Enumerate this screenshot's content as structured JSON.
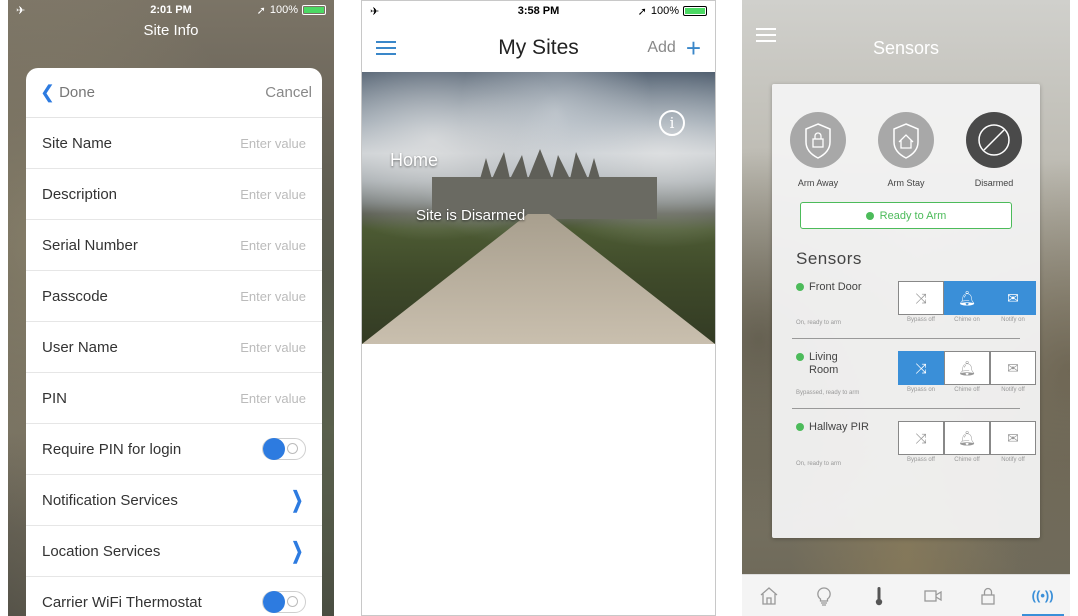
{
  "screen1": {
    "status": {
      "time": "2:01 PM",
      "battery": "100%"
    },
    "title": "Site Info",
    "done": "Done",
    "cancel": "Cancel",
    "placeholder": "Enter value",
    "fields": [
      {
        "label": "Site Name"
      },
      {
        "label": "Description"
      },
      {
        "label": "Serial Number"
      },
      {
        "label": "Passcode"
      },
      {
        "label": "User Name"
      },
      {
        "label": "PIN"
      }
    ],
    "require_pin": "Require PIN for login",
    "notification": "Notification Services",
    "location": "Location Services",
    "thermostat": "Carrier WiFi Thermostat"
  },
  "screen2": {
    "status": {
      "time": "3:58 PM",
      "battery": "100%"
    },
    "title": "My Sites",
    "add": "Add",
    "site_name": "Home",
    "site_status": "Site is Disarmed"
  },
  "screen3": {
    "title": "Sensors",
    "modes": [
      {
        "label": "Arm Away",
        "icon": "lock-shield-icon"
      },
      {
        "label": "Arm Stay",
        "icon": "home-shield-icon"
      },
      {
        "label": "Disarmed",
        "icon": "disarmed-icon"
      }
    ],
    "ready": "Ready to Arm",
    "sensors_heading": "Sensors",
    "sensors": [
      {
        "name": "Front Door",
        "status": "On, ready to arm",
        "bypass": "Bypass off",
        "chime": "Chime on",
        "notify": "Notify on"
      },
      {
        "name": "Living Room",
        "status": "Bypassed, ready to arm",
        "bypass": "Bypass on",
        "chime": "Chime off",
        "notify": "Notify off"
      },
      {
        "name": "Hallway PIR",
        "status": "On, ready to arm",
        "bypass": "Bypass off",
        "chime": "Chime off",
        "notify": "Notify off"
      }
    ],
    "colors": {
      "accent": "#3a8fd8",
      "ready": "#4cbb5a"
    }
  }
}
